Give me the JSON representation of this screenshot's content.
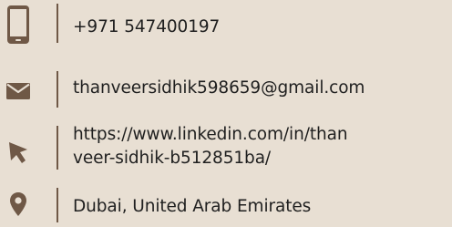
{
  "contact": {
    "phone": {
      "icon": "phone-icon",
      "text": "+971 547400197"
    },
    "email": {
      "icon": "envelope-icon",
      "text": "thanveersidhik598659@gmail.com"
    },
    "link": {
      "icon": "cursor-pointer-icon",
      "line1": "https://www.linkedin.com/in/than",
      "line2": "veer-sidhik-b512851ba/"
    },
    "location": {
      "icon": "map-pin-icon",
      "text": "Dubai, United Arab Emirates"
    }
  },
  "colors": {
    "background": "#e8dfd3",
    "accent": "#6f5846",
    "text": "#1f1f1f"
  }
}
